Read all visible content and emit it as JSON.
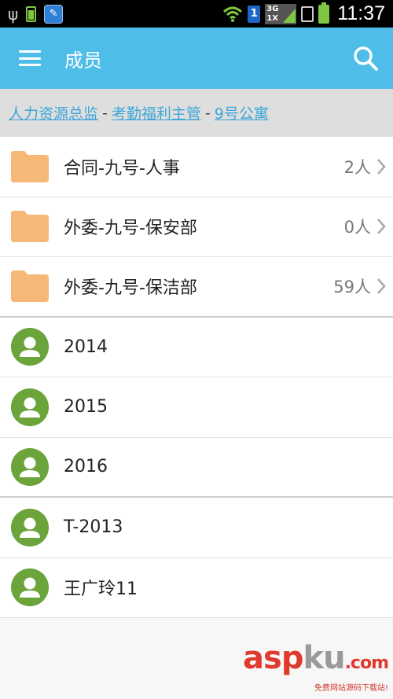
{
  "status_bar": {
    "battery_small_label": "100%",
    "network_label": "3G\n1X",
    "sim_slot": "1",
    "time": "11:37"
  },
  "app_bar": {
    "title": "成员"
  },
  "breadcrumb": [
    {
      "label": "人力资源总监",
      "link": true
    },
    {
      "label": "考勤福利主管",
      "link": true
    },
    {
      "label": "9号公寓",
      "link": true
    }
  ],
  "breadcrumb_separator": "-",
  "folders": [
    {
      "name": "合同-九号-人事",
      "count": "2人"
    },
    {
      "name": "外委-九号-保安部",
      "count": "0人"
    },
    {
      "name": "外委-九号-保洁部",
      "count": "59人"
    }
  ],
  "members": [
    {
      "name": "2014"
    },
    {
      "name": "2015"
    },
    {
      "name": "2016"
    },
    {
      "name": "T-2013"
    },
    {
      "name": "王广玲11"
    }
  ],
  "watermark": {
    "logo_part1": "asp",
    "logo_part2": "ku",
    "logo_part3": ".com",
    "subtitle": "免费网站源码下载站!"
  },
  "colors": {
    "app_bar": "#4ebde8",
    "folder": "#f5b877",
    "avatar": "#6aa43b",
    "link": "#3da6d8"
  }
}
